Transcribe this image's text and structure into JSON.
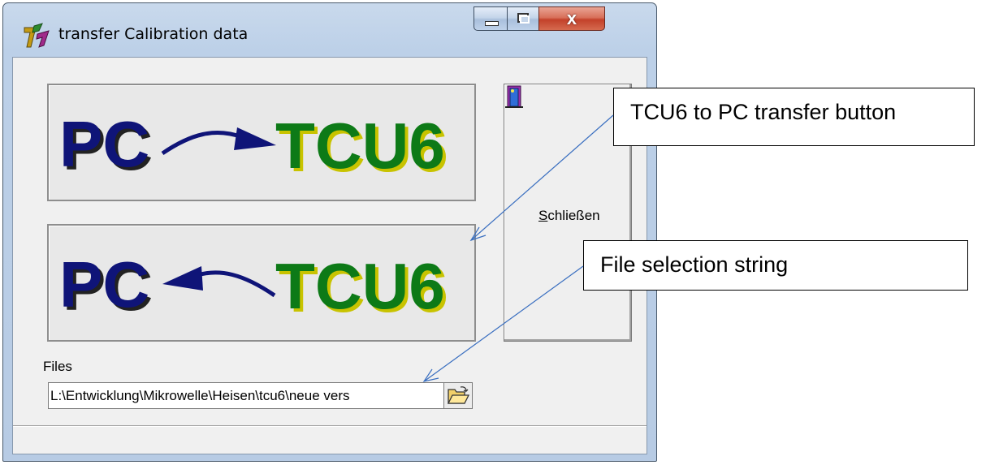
{
  "window": {
    "title": "transfer Calibration data",
    "min_label": "",
    "close_glyph": "x"
  },
  "buttons": {
    "pc_to_tcu": {
      "left": "PC",
      "right": "TCU6",
      "direction": "right"
    },
    "tcu_to_pc": {
      "left": "PC",
      "right": "TCU6",
      "direction": "left"
    },
    "close": {
      "accel": "S",
      "rest": "chließen"
    }
  },
  "files": {
    "label": "Files",
    "path": "L:\\Entwicklung\\Mikrowelle\\Heisen\\tcu6\\neue vers"
  },
  "annotations": {
    "tcu_button_note": "TCU6 to PC transfer button",
    "file_string_note": "File selection string"
  },
  "colors": {
    "pc_text": "#0f1478",
    "tcu_text": "#0d7a17",
    "shadow": "#2a2a2a",
    "arrow": "#0f1478"
  },
  "icons": [
    "app-icon",
    "minimize-icon",
    "maximize-icon",
    "close-icon",
    "exit-door-icon",
    "folder-open-icon"
  ]
}
